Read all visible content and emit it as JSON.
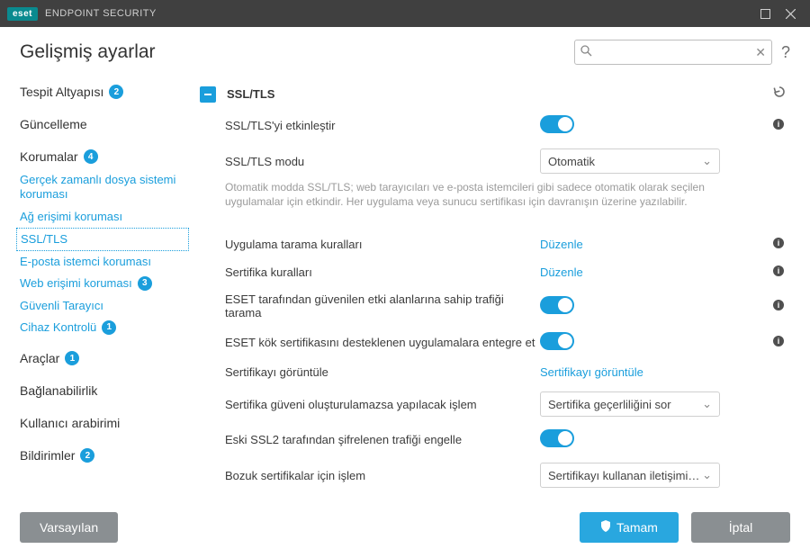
{
  "app": {
    "brand": "eset",
    "product": "ENDPOINT SECURITY"
  },
  "page": {
    "title": "Gelişmiş ayarlar"
  },
  "search": {
    "placeholder": ""
  },
  "sidebar": {
    "tespit": {
      "label": "Tespit Altyapısı",
      "badge": "2"
    },
    "guncelleme": {
      "label": "Güncelleme"
    },
    "korumalar": {
      "label": "Korumalar",
      "badge": "4",
      "items": [
        {
          "label": "Gerçek zamanlı dosya sistemi koruması"
        },
        {
          "label": "Ağ erişimi koruması"
        },
        {
          "label": "SSL/TLS"
        },
        {
          "label": "E-posta istemci koruması"
        },
        {
          "label": "Web erişimi koruması",
          "badge": "3"
        },
        {
          "label": "Güvenli Tarayıcı"
        },
        {
          "label": "Cihaz Kontrolü",
          "badge": "1"
        }
      ]
    },
    "araclar": {
      "label": "Araçlar",
      "badge": "1"
    },
    "baglan": {
      "label": "Bağlanabilirlik"
    },
    "kullanici": {
      "label": "Kullanıcı arabirimi"
    },
    "bildirim": {
      "label": "Bildirimler",
      "badge": "2"
    }
  },
  "section": {
    "title": "SSL/TLS",
    "enable": {
      "label": "SSL/TLS'yi etkinleştir"
    },
    "mode": {
      "label": "SSL/TLS modu",
      "value": "Otomatik"
    },
    "desc": "Otomatik modda SSL/TLS; web tarayıcıları ve e-posta istemcileri gibi sadece otomatik olarak seçilen uygulamalar için etkindir. Her uygulama veya sunucu sertifikası için davranışın üzerine yazılabilir.",
    "apprules": {
      "label": "Uygulama tarama kuralları",
      "link": "Düzenle"
    },
    "certrules": {
      "label": "Sertifika kuralları",
      "link": "Düzenle"
    },
    "trusteddomains": {
      "label": "ESET tarafından güvenilen etki alanlarına sahip trafiği tarama"
    },
    "rootcert": {
      "label": "ESET kök sertifikasını desteklenen uygulamalara entegre et"
    },
    "viewcert": {
      "label": "Sertifikayı görüntüle",
      "link": "Sertifikayı görüntüle"
    },
    "trustfail": {
      "label": "Sertifika güveni oluşturulamazsa yapılacak işlem",
      "value": "Sertifika geçerliliğini sor"
    },
    "ssl2": {
      "label": "Eski SSL2 tarafından şifrelenen trafiği engelle"
    },
    "broken": {
      "label": "Bozuk sertifikalar için işlem",
      "value": "Sertifikayı kullanan iletişimi e..."
    }
  },
  "footer": {
    "default": "Varsayılan",
    "ok": "Tamam",
    "cancel": "İptal"
  }
}
